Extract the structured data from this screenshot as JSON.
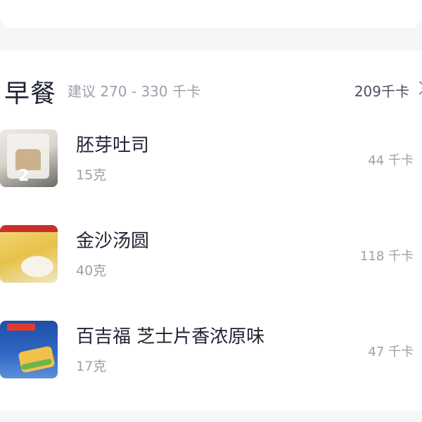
{
  "meal": {
    "title": "早餐",
    "suggestion": "建议 270 - 330 千卡",
    "total": "209千卡"
  },
  "foods": [
    {
      "name": "胚芽吐司",
      "weight": "15克",
      "kcal": "44 千卡",
      "thumb_icon": "toast-package-image"
    },
    {
      "name": "金沙汤圆",
      "weight": "40克",
      "kcal": "118 千卡",
      "thumb_icon": "tangyuan-package-image"
    },
    {
      "name": "百吉福 芝士片香浓原味",
      "weight": "17克",
      "kcal": "47 千卡",
      "thumb_icon": "cheese-slice-package-image"
    }
  ],
  "colors": {
    "background": "#f5f6f8",
    "card": "#ffffff",
    "primary_text": "#1f2433",
    "secondary_text": "#9aa0ab"
  }
}
